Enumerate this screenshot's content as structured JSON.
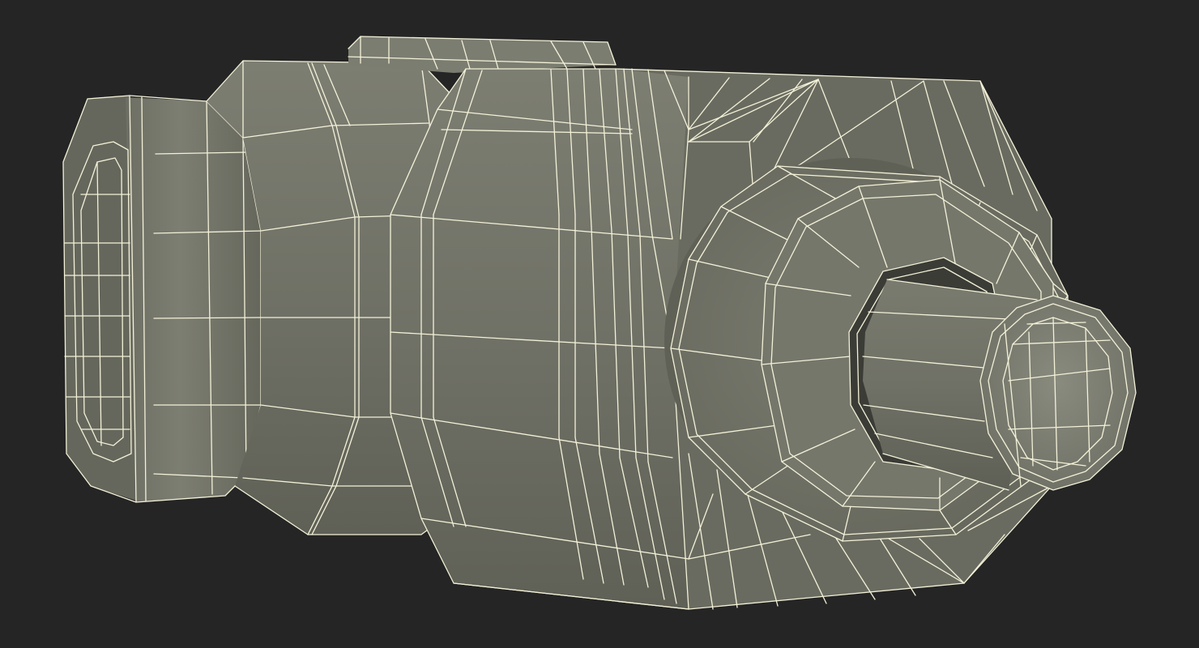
{
  "scene": {
    "subject": "wireframe-mechanical-fitting",
    "colors": {
      "background": "#252525",
      "surface_light": "#8a8b7e",
      "surface_mid": "#76776b",
      "surface_dark": "#5b5c52",
      "wire": "#f3f1d8"
    }
  }
}
